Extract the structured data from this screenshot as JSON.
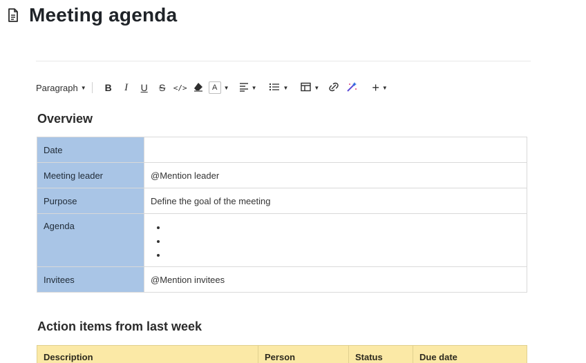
{
  "page": {
    "title": "Meeting agenda",
    "icon": "document-icon"
  },
  "toolbar": {
    "paragraph_label": "Paragraph",
    "bold_label": "B",
    "italic_label": "I",
    "underline_label": "U",
    "strike_label": "S",
    "code_label": "</>",
    "text_color_label": "A",
    "icons": [
      "eraser-icon",
      "align-left-icon",
      "bullet-list-icon",
      "table-icon",
      "link-icon",
      "magic-wand-icon",
      "plus-icon"
    ]
  },
  "overview": {
    "heading": "Overview",
    "rows": [
      {
        "label": "Date",
        "value": ""
      },
      {
        "label": "Meeting leader",
        "value": "@Mention leader"
      },
      {
        "label": "Purpose",
        "value": "Define the goal of the meeting"
      },
      {
        "label": "Agenda",
        "bullets": [
          "",
          "",
          ""
        ]
      },
      {
        "label": "Invitees",
        "value": "@Mention invitees"
      }
    ]
  },
  "action_items": {
    "heading": "Action items from last week",
    "columns": [
      "Description",
      "Person",
      "Status",
      "Due date"
    ]
  },
  "colors": {
    "label_column": "#a9c5e6",
    "action_header": "#fbe9a6"
  }
}
